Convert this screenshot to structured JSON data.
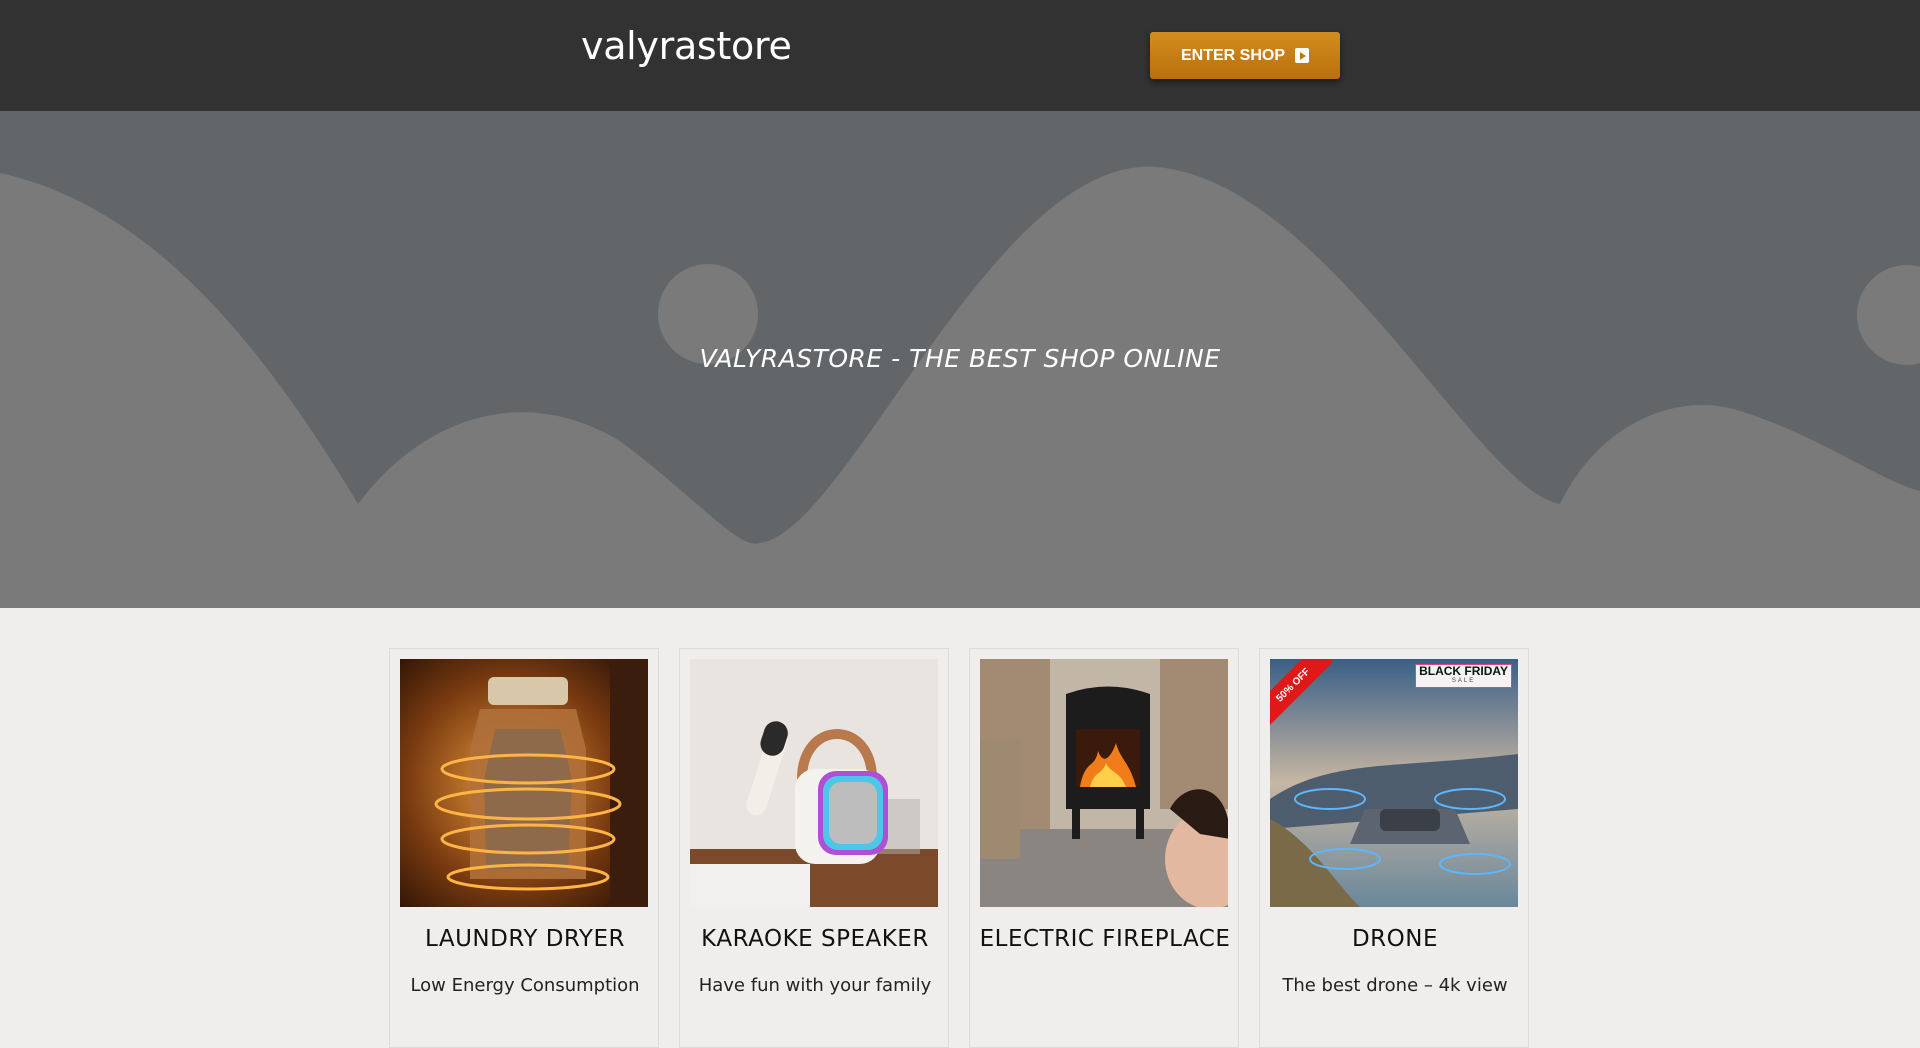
{
  "header": {
    "brand": "valyrastore",
    "enter_button_label": "ENTER SHOP",
    "enter_icon": "play-square-icon"
  },
  "hero": {
    "title": "VALYRASTORE - THE BEST SHOP ONLINE"
  },
  "products": [
    {
      "name": "LAUNDRY DRYER",
      "description": "Low Energy Consumption",
      "image": "laundry-dryer-image"
    },
    {
      "name": "KARAOKE SPEAKER",
      "description": "Have fun with your family",
      "image": "karaoke-speaker-image"
    },
    {
      "name": "ELECTRIC FIREPLACE",
      "description": "",
      "image": "electric-fireplace-image"
    },
    {
      "name": "DRONE",
      "description": "The best drone – 4k view",
      "image": "drone-image",
      "badges": {
        "discount": "50% OFF",
        "sale_title": "BLACK FRIDAY",
        "sale_sub": "SALE"
      }
    }
  ],
  "colors": {
    "topbar": "#323232",
    "button": "#c7821a",
    "hero_bg": "#636669",
    "hero_shapes": "#7a7a7a",
    "page_bg": "#efeeec"
  }
}
